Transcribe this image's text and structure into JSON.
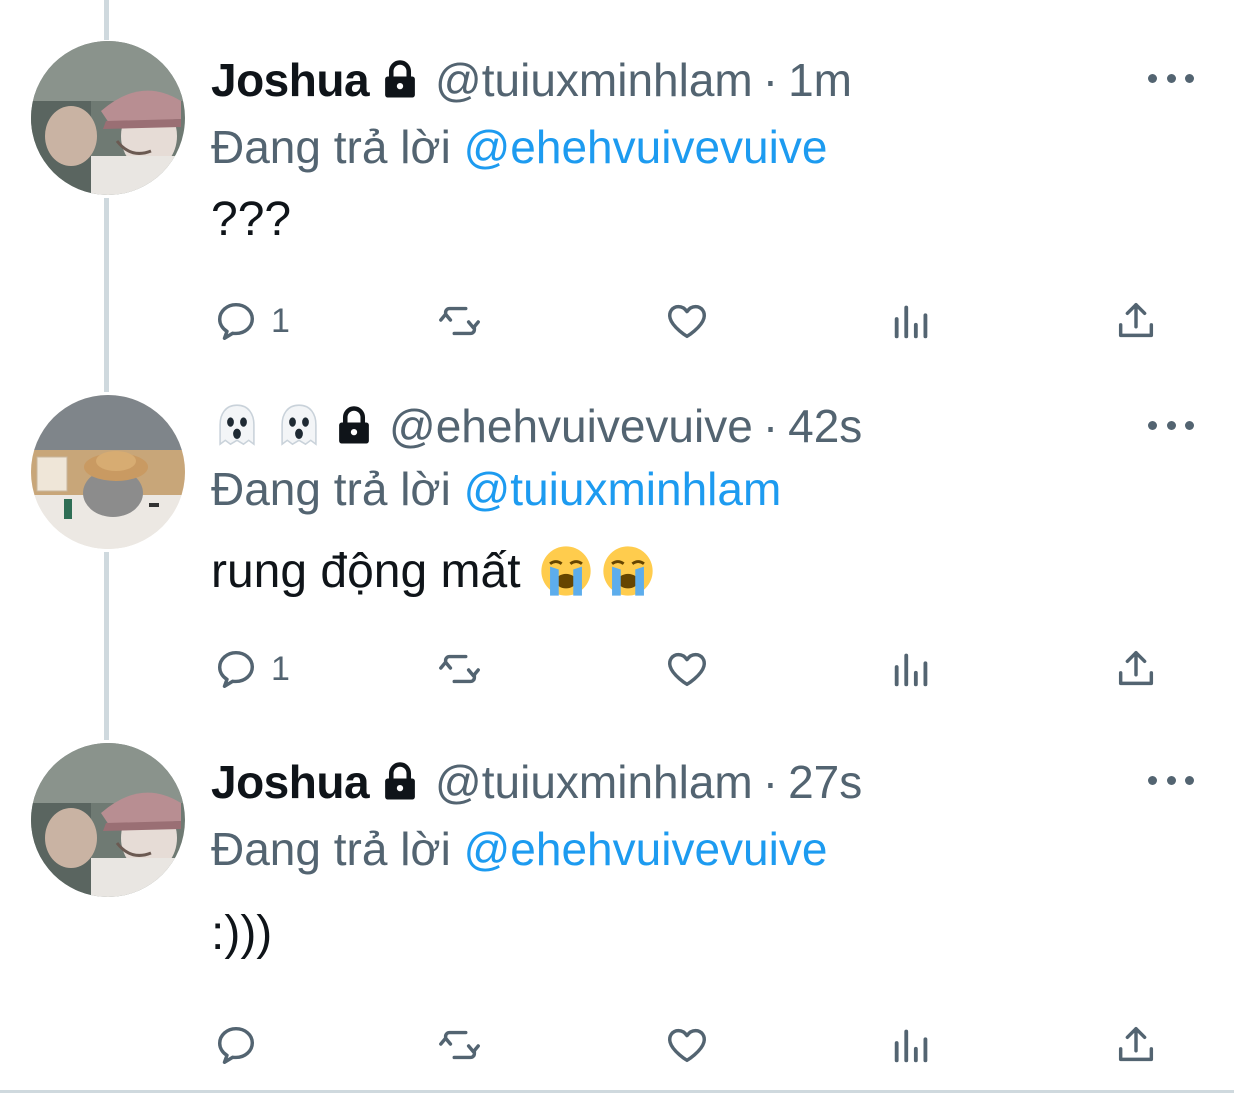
{
  "tweets": [
    {
      "display_name": "Joshua",
      "handle": "@tuiuxminhlam",
      "separator": "·",
      "time": "1m",
      "replying_prefix": "Đang trả lời",
      "replying_to": "@ehehvuivevuive",
      "text": "???",
      "reply_count": "1",
      "name_style": "text",
      "avatar": "avatar-hat-person"
    },
    {
      "display_name": "",
      "name_icons": [
        "ghost-icon",
        "ghost-icon"
      ],
      "handle": "@ehehvuivevuive",
      "separator": "·",
      "time": "42s",
      "replying_prefix": "Đang trả lời",
      "replying_to": "@tuiuxminhlam",
      "text": "rung động mất",
      "text_emojis": [
        "loudly-crying-face-icon",
        "loudly-crying-face-icon"
      ],
      "reply_count": "1",
      "name_style": "emoji",
      "avatar": "avatar-rock-hat"
    },
    {
      "display_name": "Joshua",
      "handle": "@tuiuxminhlam",
      "separator": "·",
      "time": "27s",
      "replying_prefix": "Đang trả lời",
      "replying_to": "@ehehvuivevuive",
      "text": ":)))",
      "reply_count": "",
      "name_style": "text",
      "avatar": "avatar-hat-person"
    }
  ],
  "colors": {
    "accent": "#1d9bf0",
    "secondary_text": "#536471",
    "primary_text": "#0f1419",
    "thread_line": "#cfd9de"
  }
}
